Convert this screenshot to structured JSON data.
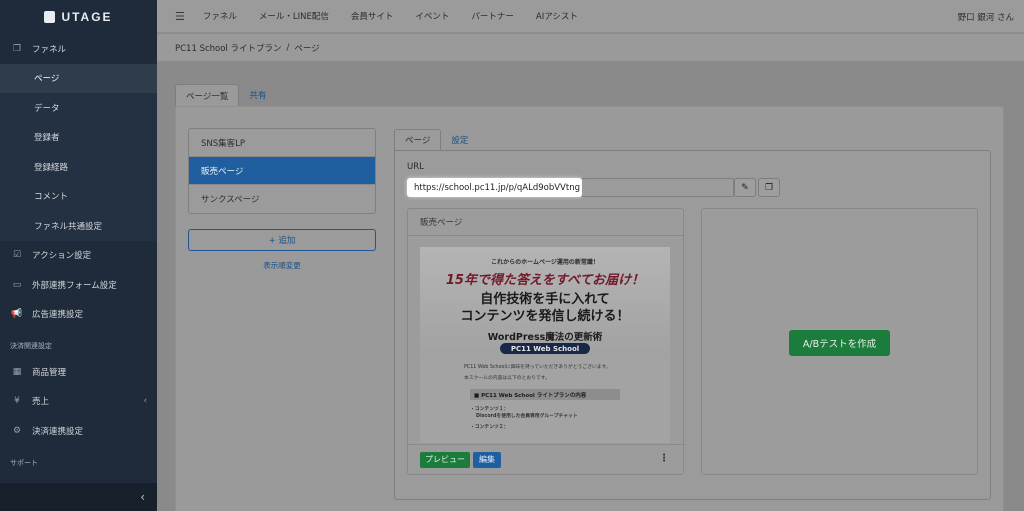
{
  "app": {
    "logo_text": "UTAGE"
  },
  "sidebar": {
    "funnel": "ファネル",
    "sub_items": [
      "ページ",
      "データ",
      "登録者",
      "登録経路",
      "コメント",
      "ファネル共通設定"
    ],
    "action": "アクション設定",
    "external_form": "外部連携フォーム設定",
    "ads": "広告連携設定",
    "section_payment": "決済関連設定",
    "products": "商品管理",
    "sales": "売上",
    "payment_link": "決済連携設定",
    "section_support": "サポート"
  },
  "topbar": {
    "menu": [
      "ファネル",
      "メール・LINE配信",
      "会員サイト",
      "イベント",
      "パートナー",
      "AIアシスト"
    ],
    "user": "野口 銀河 さん"
  },
  "breadcrumb": {
    "funnel_name": "PC11 School ライトプラン",
    "separator": "/",
    "current": "ページ"
  },
  "outer_tabs": [
    "ページ一覧",
    "共有"
  ],
  "pages": {
    "items": [
      "SNS集客LP",
      "販売ページ",
      "サンクスページ"
    ],
    "add_label": "+ 追加",
    "reorder_label": "表示順変更"
  },
  "inner_tabs": [
    "ページ",
    "設定"
  ],
  "url": {
    "label": "URL",
    "value": "https://school.pc11.jp/p/qALd9obVVtng"
  },
  "preview_card": {
    "title": "販売ページ",
    "thumbnail": {
      "line1": "これからのホームページ運用の新常識！",
      "line2": "15年で得た答えをすべてお届け！",
      "line3a": "自作技術を手に入れて",
      "line3b": "コンテンツを発信し続ける！",
      "line4": "WordPress魔法の更新術",
      "badge": "PC11 Web School",
      "body1": "PC11 Web Schoolに興味を持っていただきありがとうございます。",
      "body2": "本スクールの内容は以下のとおりです。",
      "box": "■ PC11 Web School ライトプランの内容",
      "c1": "・コンテンツ１：",
      "c1b": "Discordを使用した会員専用グループチャット",
      "c2": "・コンテンツ２："
    },
    "preview_button": "プレビュー",
    "edit_button": "編集"
  },
  "ab_test_button": "A/Bテストを作成"
}
